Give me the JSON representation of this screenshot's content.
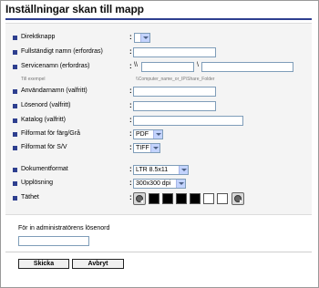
{
  "page": {
    "title": "Inställningar skan till mapp"
  },
  "form": {
    "fields": [
      {
        "label": "Direktknapp",
        "select_value": ""
      },
      {
        "label": "Fullständigt namn (erfordras)"
      },
      {
        "label": "Servicenamn (erfordras)",
        "prefix": "\\\\",
        "sep": "\\"
      },
      {
        "label": "Användarnamn (valfritt)"
      },
      {
        "label": "Lösenord (valfritt)"
      },
      {
        "label": "Katalog (valfritt)"
      },
      {
        "label": "Filformat för färg/Grå",
        "select_value": "PDF"
      },
      {
        "label": "Filformat för S/V",
        "select_value": "TIFF"
      },
      {
        "label": "Dokumentformat",
        "select_value": "LTR 8.5x11"
      },
      {
        "label": "Upplösning",
        "select_value": "300x300 dpi"
      },
      {
        "label": "Täthet"
      }
    ],
    "example": {
      "label": "Till exempel",
      "value": "\\\\Computer_name_or_IP\\Share_Folder"
    },
    "colon": ":",
    "density": {
      "swatches": [
        "black",
        "black",
        "black",
        "black",
        "white",
        "white"
      ],
      "selected_step": 2,
      "steps": 6
    }
  },
  "admin": {
    "label": "För in administratörens lösenord"
  },
  "buttons": {
    "submit": "Skicka",
    "cancel": "Avbryt"
  },
  "colors": {
    "accent": "#2e3f8f",
    "panel": "#f4f4f4"
  }
}
